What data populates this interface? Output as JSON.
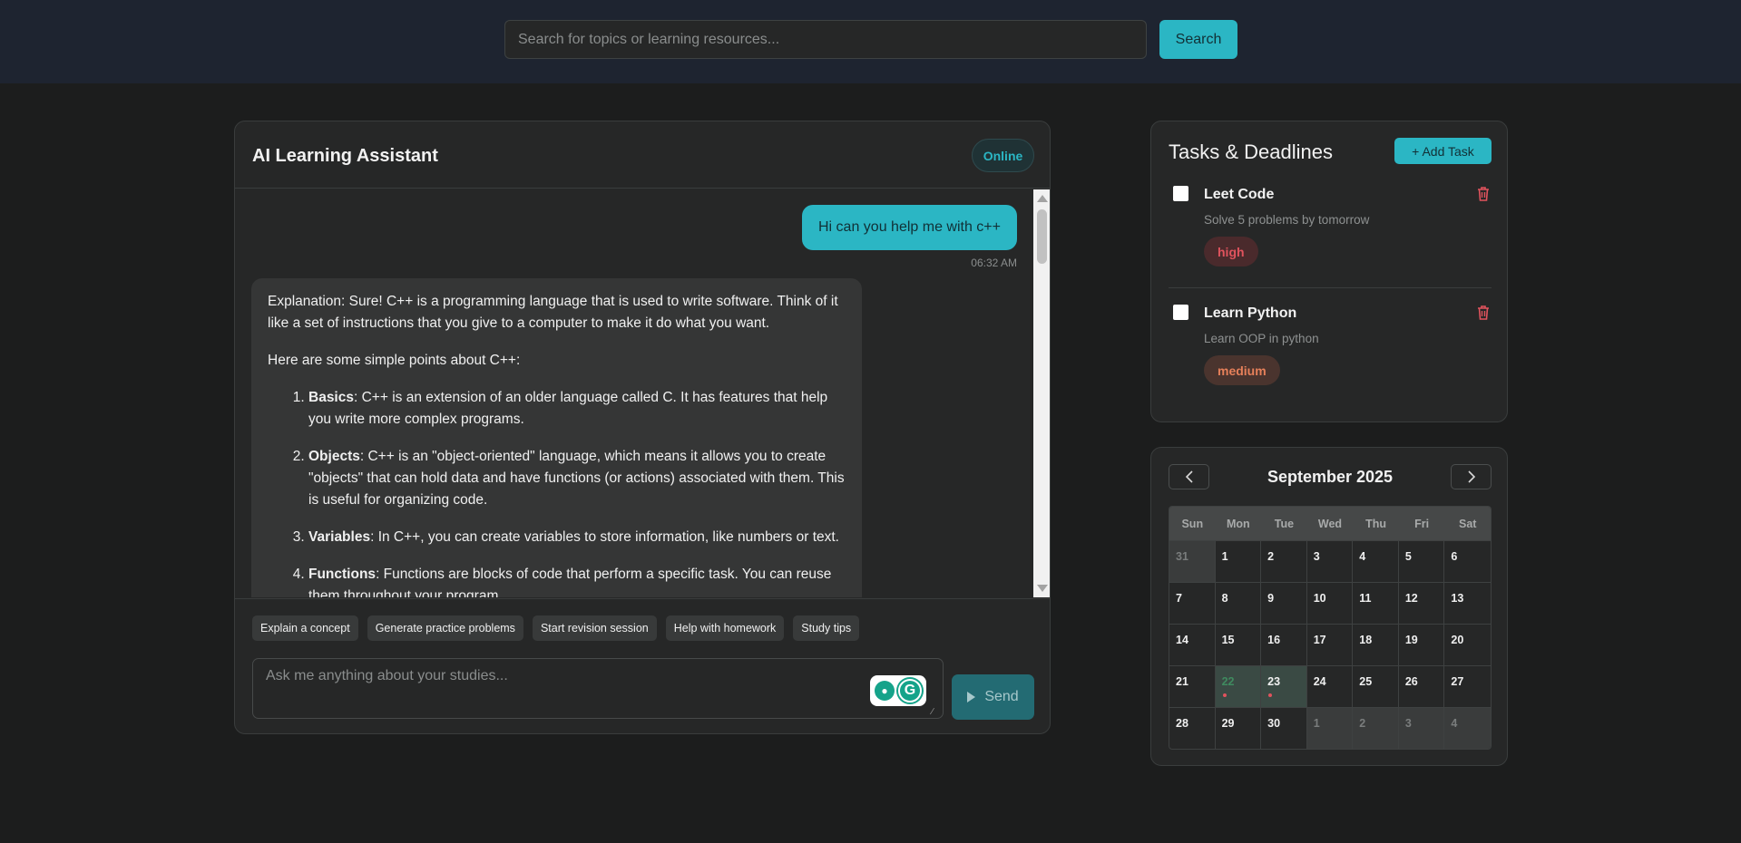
{
  "search": {
    "placeholder": "Search for topics or learning resources...",
    "button_label": "Search"
  },
  "chat": {
    "title": "AI Learning Assistant",
    "status": "Online",
    "user_message": "Hi can you help me with c++",
    "user_time": "06:32 AM",
    "ai_intro": "Explanation: Sure! C++ is a programming language that is used to write software. Think of it like a set of instructions that you give to a computer to make it do what you want.",
    "ai_lead": "Here are some simple points about C++:",
    "ai_points": [
      {
        "term": "Basics",
        "text": ": C++ is an extension of an older language called C. It has features that help you write more complex programs."
      },
      {
        "term": "Objects",
        "text": ": C++ is an \"object-oriented\" language, which means it allows you to create \"objects\" that can hold data and have functions (or actions) associated with them. This is useful for organizing code."
      },
      {
        "term": "Variables",
        "text": ": In C++, you can create variables to store information, like numbers or text."
      },
      {
        "term": "Functions",
        "text": ": Functions are blocks of code that perform a specific task. You can reuse them throughout your program."
      }
    ],
    "quick_actions": [
      "Explain a concept",
      "Generate practice problems",
      "Start revision session",
      "Help with homework",
      "Study tips"
    ],
    "input_placeholder": "Ask me anything about your studies...",
    "send_label": "Send"
  },
  "tasks": {
    "title": "Tasks & Deadlines",
    "add_label": "+ Add Task",
    "items": [
      {
        "title": "Leet Code",
        "desc": "Solve 5 problems by tomorrow",
        "priority": "high"
      },
      {
        "title": "Learn Python",
        "desc": "Learn OOP in python",
        "priority": "medium"
      }
    ]
  },
  "calendar": {
    "month": "September 2025",
    "days_of_week": [
      "Sun",
      "Mon",
      "Tue",
      "Wed",
      "Thu",
      "Fri",
      "Sat"
    ],
    "weeks": [
      [
        "31",
        "1",
        "2",
        "3",
        "4",
        "5",
        "6"
      ],
      [
        "7",
        "8",
        "9",
        "10",
        "11",
        "12",
        "13"
      ],
      [
        "14",
        "15",
        "16",
        "17",
        "18",
        "19",
        "20"
      ],
      [
        "21",
        "22",
        "23",
        "24",
        "25",
        "26",
        "27"
      ],
      [
        "28",
        "29",
        "30",
        "1",
        "2",
        "3",
        "4"
      ]
    ],
    "prev_icon": "chevron-left-icon",
    "next_icon": "chevron-right-icon"
  },
  "colors": {
    "accent": "#2bb6c4",
    "background": "#1c1d1d",
    "panel": "#262727",
    "high": "#e0535d",
    "medium": "#e6805a"
  }
}
